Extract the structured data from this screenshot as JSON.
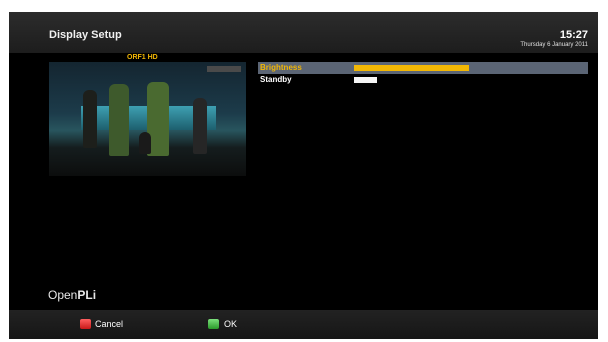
{
  "header": {
    "title": "Display Setup",
    "time": "15:27",
    "date": "Thursday 6 January 2011"
  },
  "preview": {
    "channel": "ORF1 HD"
  },
  "settings": [
    {
      "label": "Brightness",
      "value_fraction": 0.5,
      "selected": true
    },
    {
      "label": "Standby",
      "value_fraction": 0.1,
      "selected": false
    }
  ],
  "brand": {
    "prefix": "Open",
    "suffix": "PLi"
  },
  "footer": {
    "cancel_label": "Cancel",
    "ok_label": "OK"
  },
  "colors": {
    "highlight_text": "#f2b705",
    "selected_row": "#5b6575",
    "red_key": "#d42020",
    "green_key": "#3aac3a"
  }
}
